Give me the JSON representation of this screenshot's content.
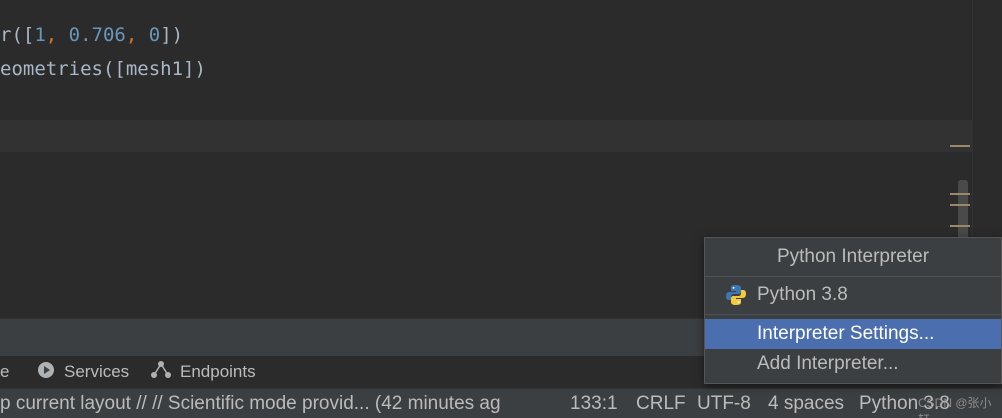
{
  "editor": {
    "line1": {
      "prefix": "r([",
      "n1": "1",
      "sep1": ", ",
      "n2": "0.706",
      "sep2": ", ",
      "n3": "0",
      "suffix": "])"
    },
    "line2": {
      "text": "eometries([mesh1])"
    }
  },
  "toolwindows": {
    "cut_label": "e",
    "services_label": "Services",
    "endpoints_label": "Endpoints"
  },
  "statusbar": {
    "message": "p current layout // // Scientific mode provid... (42 minutes ag",
    "position": "133:1",
    "line_sep": "CRLF",
    "encoding": "UTF-8",
    "indent": "4 spaces",
    "interpreter": "Python 3.8"
  },
  "popup": {
    "title": "Python Interpreter",
    "current": "Python 3.8",
    "settings": "Interpreter Settings...",
    "add": "Add Interpreter..."
  },
  "watermark": "CSDN @张小轩",
  "colors": {
    "editor_bg": "#2b2b2b",
    "panel_bg": "#3c3f41",
    "selection": "#4b6eaf",
    "number": "#6897bb",
    "punctuation": "#cc7832"
  }
}
